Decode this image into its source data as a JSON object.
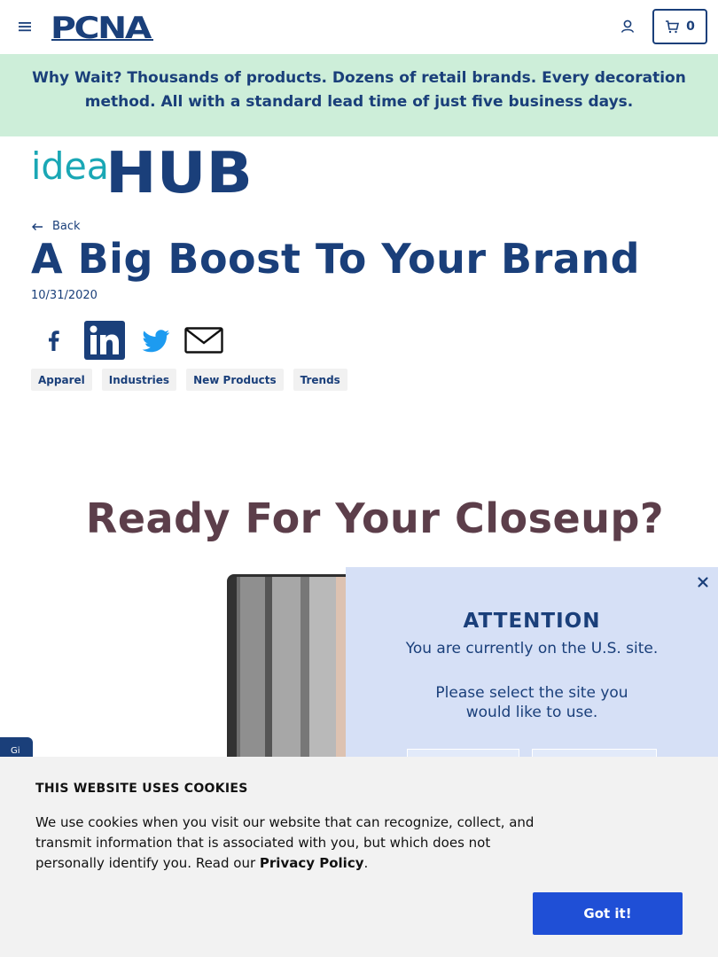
{
  "header": {
    "logo_text": "PCNA",
    "cart_count": "0"
  },
  "promo": {
    "text": "Why Wait? Thousands of products. Dozens of retail brands. Every decoration method. All with a standard lead time of just five business days."
  },
  "brand": {
    "ideahub_light": "idea",
    "ideahub_bold": "HUB"
  },
  "article": {
    "back_label": "Back",
    "title": "A Big Boost To Your Brand",
    "date": "10/31/2020",
    "tags": [
      "Apparel",
      "Industries",
      "New Products",
      "Trends"
    ],
    "hero_heading": "Ready For Your Closeup?"
  },
  "share": {
    "icons": [
      "facebook-icon",
      "linkedin-icon",
      "twitter-icon",
      "email-icon"
    ]
  },
  "side_tab": {
    "label": "Gi"
  },
  "modal": {
    "title": "ATTENTION",
    "line1": "You are currently on the U.S. site.",
    "line2": "Please select the site you would like to use."
  },
  "cookie": {
    "title": "THIS WEBSITE USES COOKIES",
    "text": "We use cookies when you visit our website that can recognize, collect, and transmit information that is associated with you, but which does not personally identify you. Read our ",
    "link": "Privacy Policy",
    "end": ".",
    "button": "Got it!"
  },
  "colors": {
    "navy": "#1a3f7a",
    "promo_bg": "#cdeed9",
    "modal_bg": "#d6e0f6",
    "cookie_bg": "#f2f2f2",
    "button_blue": "#1f4fd6",
    "ideahub_teal": "#1aa7b5"
  }
}
